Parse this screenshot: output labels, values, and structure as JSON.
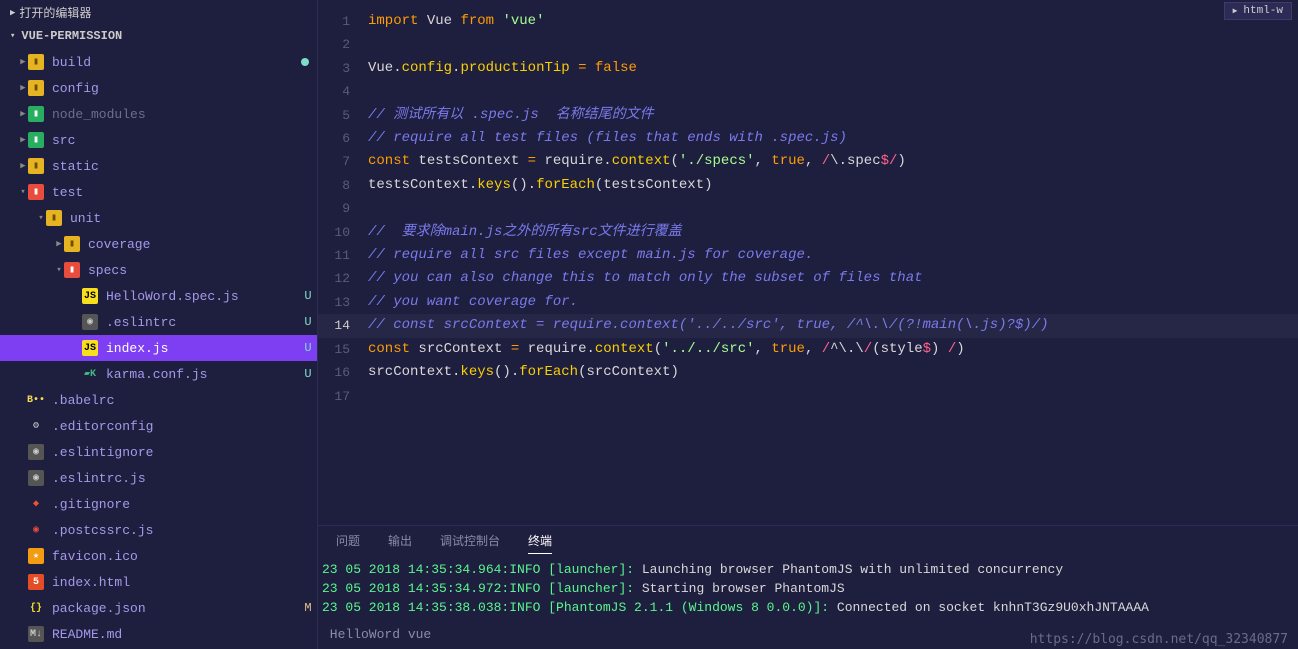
{
  "sidebar": {
    "open_editors_label": "打开的编辑器",
    "project_name": "VUE-PERMISSION",
    "tree": [
      {
        "label": "build",
        "indent": 1,
        "icon": "folder",
        "expand": "▶",
        "dot": true
      },
      {
        "label": "config",
        "indent": 1,
        "icon": "folder",
        "expand": "▶"
      },
      {
        "label": "node_modules",
        "indent": 1,
        "icon": "folder-green",
        "expand": "▶",
        "dim": true
      },
      {
        "label": "src",
        "indent": 1,
        "icon": "folder-green",
        "expand": "▶"
      },
      {
        "label": "static",
        "indent": 1,
        "icon": "folder",
        "expand": "▶"
      },
      {
        "label": "test",
        "indent": 1,
        "icon": "folder-red",
        "expand": "▾"
      },
      {
        "label": "unit",
        "indent": 2,
        "icon": "folder",
        "expand": "▾"
      },
      {
        "label": "coverage",
        "indent": 3,
        "icon": "folder",
        "expand": "▶"
      },
      {
        "label": "specs",
        "indent": 3,
        "icon": "folder-red",
        "expand": "▾"
      },
      {
        "label": "HelloWord.spec.js",
        "indent": 4,
        "icon": "js",
        "status": "U"
      },
      {
        "label": ".eslintrc",
        "indent": 4,
        "icon": "config",
        "status": "U"
      },
      {
        "label": "index.js",
        "indent": 4,
        "icon": "js",
        "status": "U",
        "selected": true
      },
      {
        "label": "karma.conf.js",
        "indent": 4,
        "icon": "karma",
        "status": "U"
      },
      {
        "label": ".babelrc",
        "indent": 1,
        "icon": "babel"
      },
      {
        "label": ".editorconfig",
        "indent": 1,
        "icon": "config-white"
      },
      {
        "label": ".eslintignore",
        "indent": 1,
        "icon": "config"
      },
      {
        "label": ".eslintrc.js",
        "indent": 1,
        "icon": "config"
      },
      {
        "label": ".gitignore",
        "indent": 1,
        "icon": "git"
      },
      {
        "label": ".postcssrc.js",
        "indent": 1,
        "icon": "config-red"
      },
      {
        "label": "favicon.ico",
        "indent": 1,
        "icon": "fav"
      },
      {
        "label": "index.html",
        "indent": 1,
        "icon": "html"
      },
      {
        "label": "package.json",
        "indent": 1,
        "icon": "json",
        "status": "M"
      },
      {
        "label": "README.md",
        "indent": 1,
        "icon": "md"
      }
    ]
  },
  "tab_indicator": "html-w",
  "editor": {
    "current_line": 14,
    "lines": [
      {
        "n": 1,
        "html": "<span class='tk-kw'>import</span> <span class='tk-id'>Vue</span> <span class='tk-kw'>from</span> <span class='tk-str'>'vue'</span>"
      },
      {
        "n": 2,
        "html": ""
      },
      {
        "n": 3,
        "html": "<span class='tk-id'>Vue</span><span class='tk-pn'>.</span><span class='tk-prop'>config</span><span class='tk-pn'>.</span><span class='tk-prop'>productionTip</span> <span class='tk-op'>=</span> <span class='tk-bool'>false</span>"
      },
      {
        "n": 4,
        "html": ""
      },
      {
        "n": 5,
        "html": "<span class='tk-cm'>// 测试所有以 .spec.js  名称结尾的文件</span>"
      },
      {
        "n": 6,
        "html": "<span class='tk-cm'>// require all test files (files that ends with .spec.js)</span>"
      },
      {
        "n": 7,
        "html": "<span class='tk-kw'>const</span> <span class='tk-id'>testsContext</span> <span class='tk-op'>=</span> <span class='tk-id'>require</span><span class='tk-pn'>.</span><span class='tk-fn'>context</span><span class='tk-pn'>(</span><span class='tk-str'>'./specs'</span><span class='tk-pn'>,</span> <span class='tk-bool'>true</span><span class='tk-pn'>,</span> <span class='tk-re'>/</span><span class='tk-id'>\\</span><span class='tk-pn'>.</span><span class='tk-id'>spec</span><span class='tk-re'>$/</span><span class='tk-pn'>)</span>"
      },
      {
        "n": 8,
        "html": "<span class='tk-id'>testsContext</span><span class='tk-pn'>.</span><span class='tk-fn'>keys</span><span class='tk-pn'>().</span><span class='tk-fn'>forEach</span><span class='tk-pn'>(</span><span class='tk-id'>testsContext</span><span class='tk-pn'>)</span>"
      },
      {
        "n": 9,
        "html": ""
      },
      {
        "n": 10,
        "html": "<span class='tk-cm'>//  要求除main.js之外的所有src文件进行覆盖</span>"
      },
      {
        "n": 11,
        "html": "<span class='tk-cm'>// require all src files except main.js for coverage.</span>"
      },
      {
        "n": 12,
        "html": "<span class='tk-cm'>// you can also change this to match only the subset of files that</span>"
      },
      {
        "n": 13,
        "html": "<span class='tk-cm'>// you want coverage for.</span>"
      },
      {
        "n": 14,
        "html": "<span class='tk-cm'>// const srcContext = require.context('../../src', true, /^\\.\\/(?!main(\\.js)?$)/)</span>"
      },
      {
        "n": 15,
        "html": "<span class='tk-kw'>const</span> <span class='tk-id'>srcContext</span> <span class='tk-op'>=</span> <span class='tk-id'>require</span><span class='tk-pn'>.</span><span class='tk-fn'>context</span><span class='tk-pn'>(</span><span class='tk-str'>'../../src'</span><span class='tk-pn'>,</span> <span class='tk-bool'>true</span><span class='tk-pn'>,</span> <span class='tk-re'>/</span><span class='tk-id'>^\\</span><span class='tk-pn'>.</span><span class='tk-id'>\\</span><span class='tk-re'>/</span><span class='tk-pn'>(</span><span class='tk-id'>style</span><span class='tk-re'>$</span><span class='tk-pn'>)</span> <span class='tk-re'>/</span><span class='tk-pn'>)</span>"
      },
      {
        "n": 16,
        "html": "<span class='tk-id'>srcContext</span><span class='tk-pn'>.</span><span class='tk-fn'>keys</span><span class='tk-pn'>().</span><span class='tk-fn'>forEach</span><span class='tk-pn'>(</span><span class='tk-id'>srcContext</span><span class='tk-pn'>)</span>"
      },
      {
        "n": 17,
        "html": ""
      }
    ]
  },
  "terminal": {
    "tabs": [
      "问题",
      "输出",
      "调试控制台",
      "终端"
    ],
    "active_tab": 3,
    "lines": [
      "23 05 2018 14:35:34.964:INFO [launcher]: |Launching browser PhantomJS with unlimited concurrency",
      "23 05 2018 14:35:34.972:INFO [launcher]: |Starting browser PhantomJS",
      "23 05 2018 14:35:38.038:INFO [PhantomJS 2.1.1 (Windows 8 0.0.0)]: |Connected on socket knhnT3Gz9U0xhJNTAAAA"
    ],
    "bottom_text": "HelloWord vue"
  },
  "watermark": "https://blog.csdn.net/qq_32340877"
}
